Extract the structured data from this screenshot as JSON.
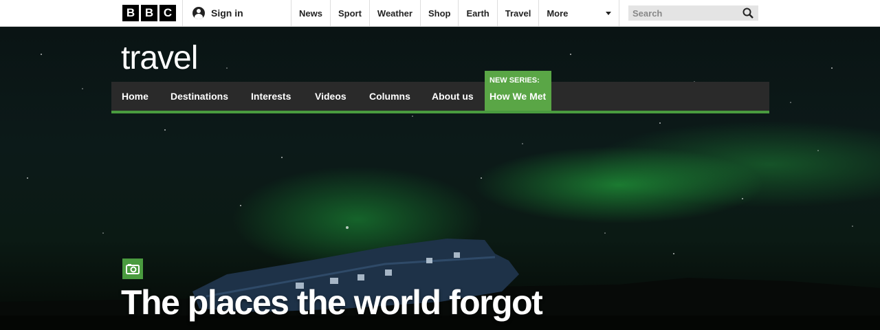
{
  "brand": {
    "logo_letters": [
      "B",
      "B",
      "C"
    ]
  },
  "header": {
    "signin_label": "Sign in",
    "nav": [
      "News",
      "Sport",
      "Weather",
      "Shop",
      "Earth",
      "Travel",
      "More"
    ],
    "search_placeholder": "Search"
  },
  "site": {
    "logo": "travel",
    "nav": [
      "Home",
      "Destinations",
      "Interests",
      "Videos",
      "Columns",
      "About us"
    ],
    "promo": {
      "label": "NEW SERIES:",
      "title": "How We Met"
    }
  },
  "hero": {
    "headline": "The places the world forgot",
    "badge_icon": "camera-icon"
  },
  "colors": {
    "accent": "#5aa646",
    "nav_bar": "#2a2a2a",
    "nav_border": "#4a9b3f"
  }
}
